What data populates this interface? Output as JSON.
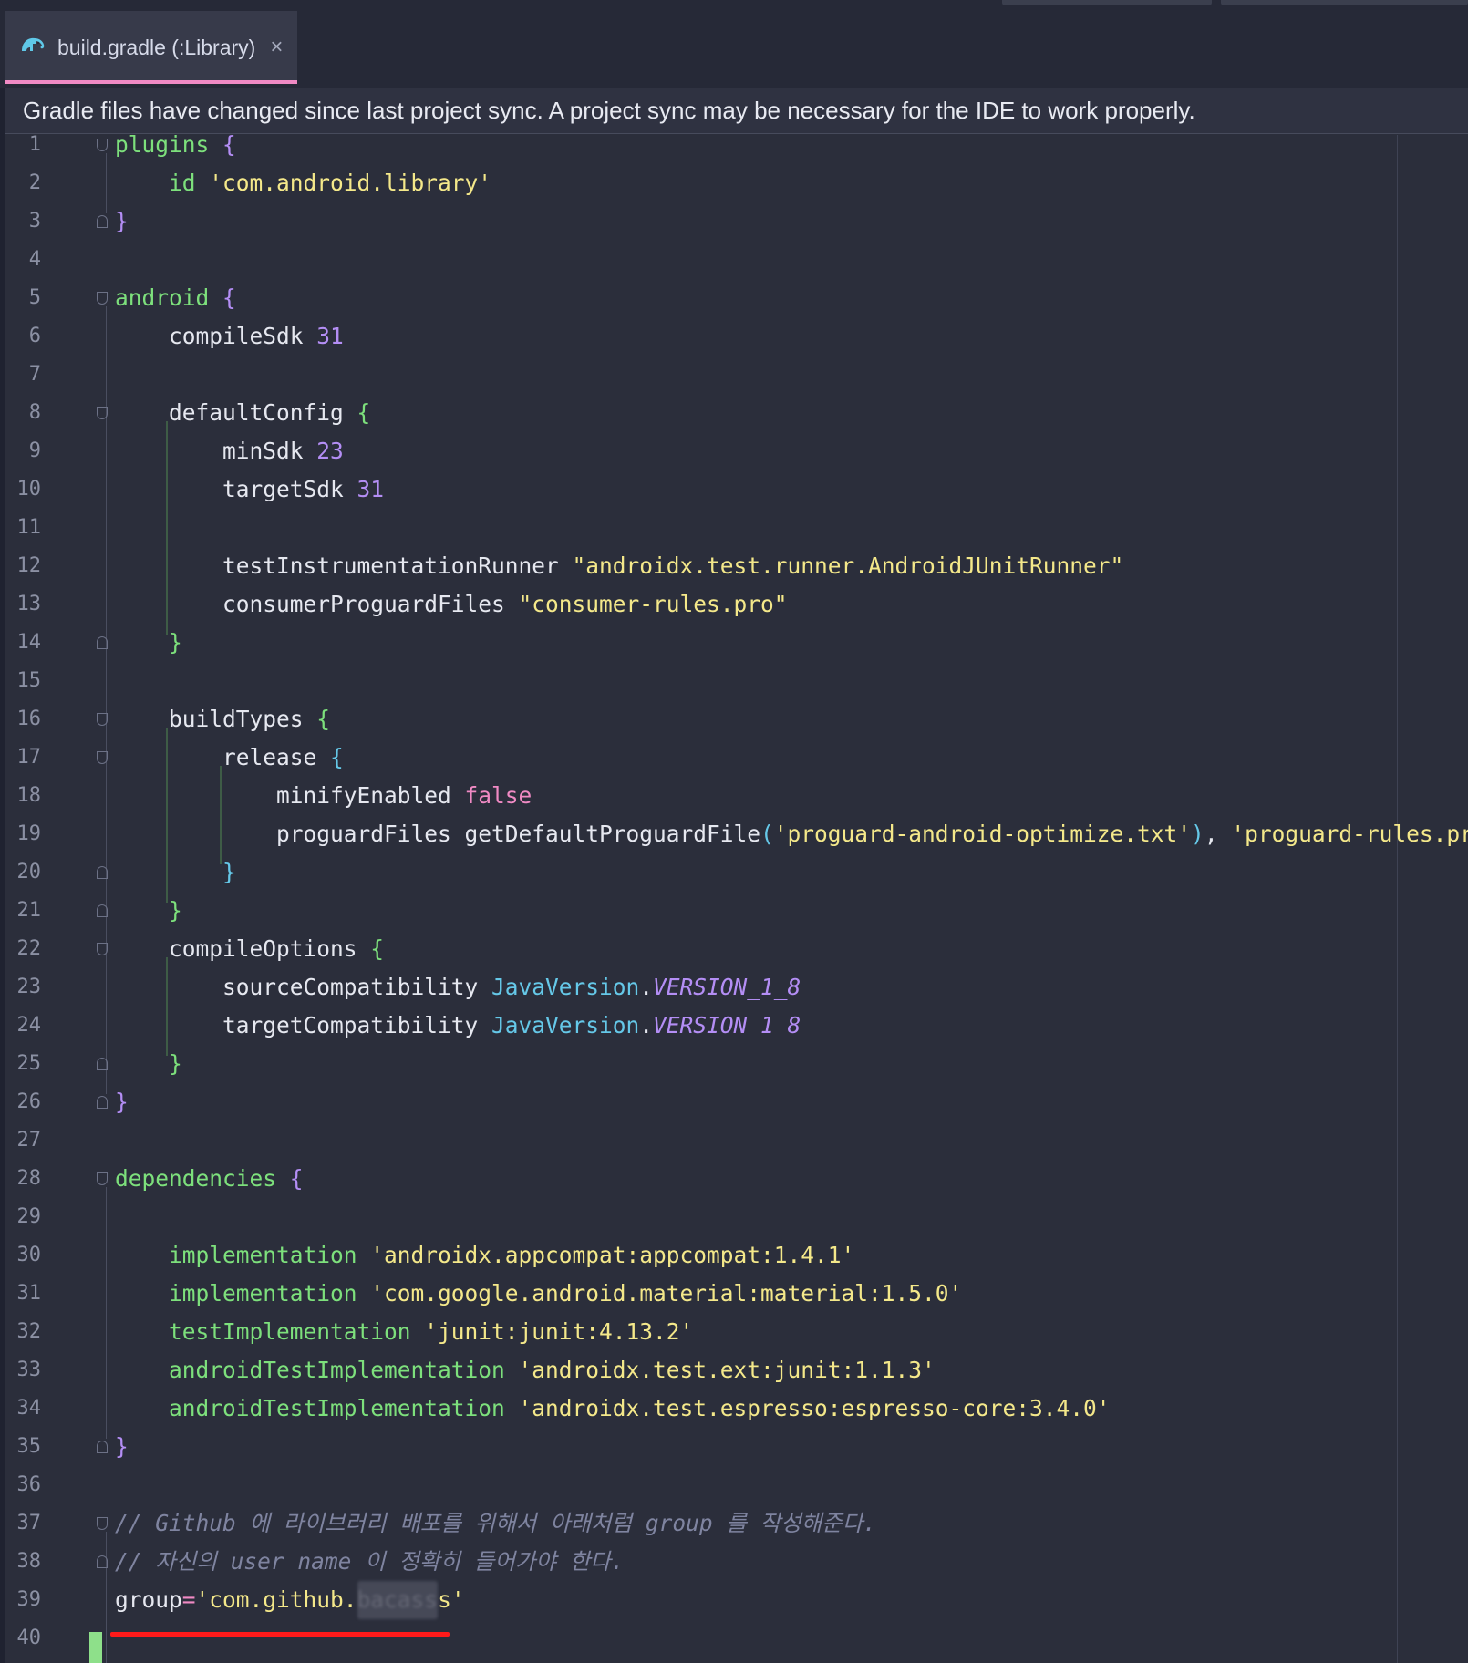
{
  "tab": {
    "icon": "gradle-elephant-icon",
    "label": "build.gradle (:Library)",
    "close": "×"
  },
  "banner": {
    "message": "Gradle files have changed since last project sync. A project sync may be necessary for the IDE to work properly."
  },
  "colors": {
    "background": "#2b2e3b",
    "tab_active_underline": "#f08ac4",
    "keyword": "#7de07c",
    "brace": "#b48ef5",
    "string": "#f4e88a",
    "class_ref": "#65c8e8",
    "boolean": "#f08ac4",
    "comment": "#7f84a0",
    "annotation_underline": "#ff1a1a"
  },
  "editor": {
    "line_numbers": [
      "1",
      "2",
      "3",
      "4",
      "5",
      "6",
      "7",
      "8",
      "9",
      "10",
      "11",
      "12",
      "13",
      "14",
      "15",
      "16",
      "17",
      "18",
      "19",
      "20",
      "21",
      "22",
      "23",
      "24",
      "25",
      "26",
      "27",
      "28",
      "29",
      "30",
      "31",
      "32",
      "33",
      "34",
      "35",
      "36",
      "37",
      "38",
      "39",
      "40"
    ],
    "lines": [
      {
        "n": 1,
        "tokens": [
          [
            "plugins",
            "k-green"
          ],
          [
            " ",
            "k-white"
          ],
          [
            "{",
            "k-purple"
          ]
        ]
      },
      {
        "n": 2,
        "tokens": [
          [
            "    ",
            "k-white"
          ],
          [
            "id",
            "k-green"
          ],
          [
            " ",
            "k-white"
          ],
          [
            "'com.android.library'",
            "k-yellow"
          ]
        ]
      },
      {
        "n": 3,
        "tokens": [
          [
            "}",
            "k-purple"
          ]
        ]
      },
      {
        "n": 4,
        "tokens": []
      },
      {
        "n": 5,
        "tokens": [
          [
            "android",
            "k-green"
          ],
          [
            " ",
            "k-white"
          ],
          [
            "{",
            "k-purple"
          ]
        ]
      },
      {
        "n": 6,
        "tokens": [
          [
            "    compileSdk ",
            "k-white"
          ],
          [
            "31",
            "k-purple"
          ]
        ]
      },
      {
        "n": 7,
        "tokens": []
      },
      {
        "n": 8,
        "tokens": [
          [
            "    defaultConfig ",
            "k-white"
          ],
          [
            "{",
            "k-green"
          ]
        ]
      },
      {
        "n": 9,
        "tokens": [
          [
            "        minSdk ",
            "k-white"
          ],
          [
            "23",
            "k-purple"
          ]
        ]
      },
      {
        "n": 10,
        "tokens": [
          [
            "        targetSdk ",
            "k-white"
          ],
          [
            "31",
            "k-purple"
          ]
        ]
      },
      {
        "n": 11,
        "tokens": []
      },
      {
        "n": 12,
        "tokens": [
          [
            "        testInstrumentationRunner ",
            "k-white"
          ],
          [
            "\"androidx.test.runner.AndroidJUnitRunner\"",
            "k-yellow"
          ]
        ]
      },
      {
        "n": 13,
        "tokens": [
          [
            "        consumerProguardFiles ",
            "k-white"
          ],
          [
            "\"consumer-rules.pro\"",
            "k-yellow"
          ]
        ]
      },
      {
        "n": 14,
        "tokens": [
          [
            "    ",
            "k-white"
          ],
          [
            "}",
            "k-green"
          ]
        ]
      },
      {
        "n": 15,
        "tokens": []
      },
      {
        "n": 16,
        "tokens": [
          [
            "    buildTypes ",
            "k-white"
          ],
          [
            "{",
            "k-green"
          ]
        ]
      },
      {
        "n": 17,
        "tokens": [
          [
            "        release ",
            "k-white"
          ],
          [
            "{",
            "k-cyan"
          ]
        ]
      },
      {
        "n": 18,
        "tokens": [
          [
            "            minifyEnabled ",
            "k-white"
          ],
          [
            "false",
            "k-pink"
          ]
        ]
      },
      {
        "n": 19,
        "tokens": [
          [
            "            proguardFiles getDefaultProguardFile",
            "k-white"
          ],
          [
            "(",
            "k-cyan"
          ],
          [
            "'proguard-android-optimize.txt'",
            "k-yellow"
          ],
          [
            ")",
            "k-cyan"
          ],
          [
            ", ",
            "k-white"
          ],
          [
            "'proguard-rules.pro'",
            "k-yellow"
          ]
        ]
      },
      {
        "n": 20,
        "tokens": [
          [
            "        ",
            "k-white"
          ],
          [
            "}",
            "k-cyan"
          ]
        ]
      },
      {
        "n": 21,
        "tokens": [
          [
            "    ",
            "k-white"
          ],
          [
            "}",
            "k-green"
          ]
        ]
      },
      {
        "n": 22,
        "tokens": [
          [
            "    compileOptions ",
            "k-white"
          ],
          [
            "{",
            "k-green"
          ]
        ]
      },
      {
        "n": 23,
        "tokens": [
          [
            "        sourceCompatibility ",
            "k-white"
          ],
          [
            "JavaVersion",
            "k-cyan"
          ],
          [
            ".",
            "k-white"
          ],
          [
            "VERSION_1_8",
            "k-italic"
          ]
        ]
      },
      {
        "n": 24,
        "tokens": [
          [
            "        targetCompatibility ",
            "k-white"
          ],
          [
            "JavaVersion",
            "k-cyan"
          ],
          [
            ".",
            "k-white"
          ],
          [
            "VERSION_1_8",
            "k-italic"
          ]
        ]
      },
      {
        "n": 25,
        "tokens": [
          [
            "    ",
            "k-white"
          ],
          [
            "}",
            "k-green"
          ]
        ]
      },
      {
        "n": 26,
        "tokens": [
          [
            "}",
            "k-purple"
          ]
        ]
      },
      {
        "n": 27,
        "tokens": []
      },
      {
        "n": 28,
        "tokens": [
          [
            "dependencies",
            "k-green"
          ],
          [
            " ",
            "k-white"
          ],
          [
            "{",
            "k-purple"
          ]
        ]
      },
      {
        "n": 29,
        "tokens": []
      },
      {
        "n": 30,
        "tokens": [
          [
            "    ",
            "k-white"
          ],
          [
            "implementation",
            "k-green"
          ],
          [
            " ",
            "k-white"
          ],
          [
            "'androidx.appcompat:appcompat:1.4.1'",
            "k-yellow"
          ]
        ]
      },
      {
        "n": 31,
        "tokens": [
          [
            "    ",
            "k-white"
          ],
          [
            "implementation",
            "k-green"
          ],
          [
            " ",
            "k-white"
          ],
          [
            "'com.google.android.material:material:1.5.0'",
            "k-yellow"
          ]
        ]
      },
      {
        "n": 32,
        "tokens": [
          [
            "    ",
            "k-white"
          ],
          [
            "testImplementation",
            "k-green"
          ],
          [
            " ",
            "k-white"
          ],
          [
            "'junit:junit:4.13.2'",
            "k-yellow"
          ]
        ]
      },
      {
        "n": 33,
        "tokens": [
          [
            "    ",
            "k-white"
          ],
          [
            "androidTestImplementation",
            "k-green"
          ],
          [
            " ",
            "k-white"
          ],
          [
            "'androidx.test.ext:junit:1.1.3'",
            "k-yellow"
          ]
        ]
      },
      {
        "n": 34,
        "tokens": [
          [
            "    ",
            "k-white"
          ],
          [
            "androidTestImplementation",
            "k-green"
          ],
          [
            " ",
            "k-white"
          ],
          [
            "'androidx.test.espresso:espresso-core:3.4.0'",
            "k-yellow"
          ]
        ]
      },
      {
        "n": 35,
        "tokens": [
          [
            "}",
            "k-purple"
          ]
        ]
      },
      {
        "n": 36,
        "tokens": []
      },
      {
        "n": 37,
        "tokens": [
          [
            "// Github 에 라이브러리 배포를 위해서 아래처럼 group 를 작성해준다.",
            "k-comment"
          ]
        ]
      },
      {
        "n": 38,
        "tokens": [
          [
            "// 자신의 user name 이 정확히 들어가야 한다.",
            "k-comment"
          ]
        ]
      },
      {
        "n": 39,
        "tokens": [
          [
            "group",
            "k-white"
          ],
          [
            "=",
            "k-pink"
          ],
          [
            "'com.github.",
            "k-yellow"
          ],
          [
            "bacass",
            "blur"
          ],
          [
            "s'",
            "k-yellow"
          ]
        ]
      },
      {
        "n": 40,
        "tokens": []
      }
    ]
  }
}
